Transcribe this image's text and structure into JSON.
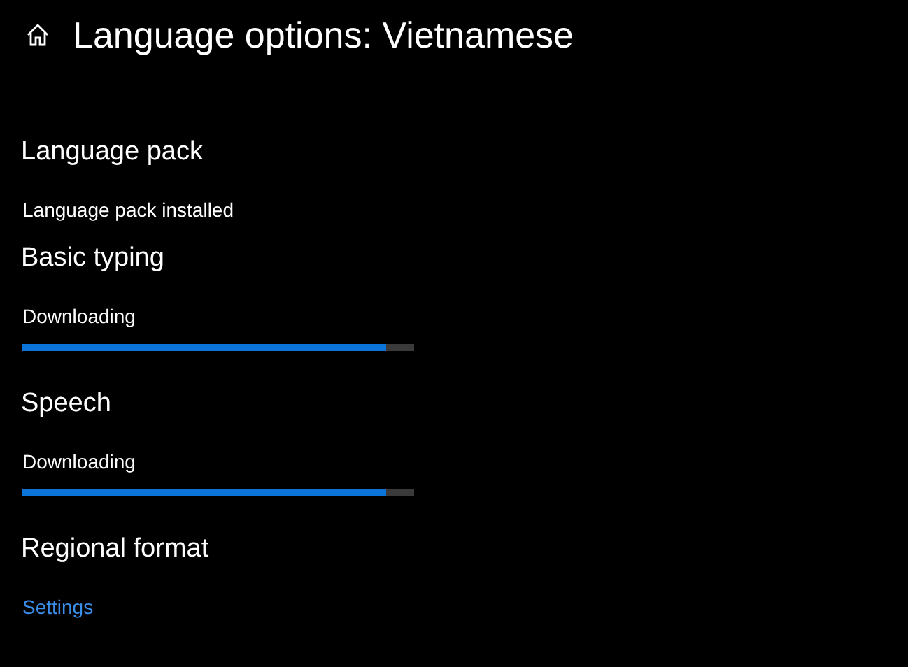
{
  "header": {
    "title": "Language options: Vietnamese"
  },
  "sections": [
    {
      "heading": "Language pack",
      "kind": "text",
      "text": "Language pack installed"
    },
    {
      "heading": "Basic typing",
      "kind": "progress",
      "text": "Downloading",
      "level": 0.93
    },
    {
      "heading": "Speech",
      "kind": "progress",
      "text": "Downloading",
      "level": 0.93
    },
    {
      "heading": "Regional format",
      "kind": "link",
      "text": "Settings"
    }
  ]
}
